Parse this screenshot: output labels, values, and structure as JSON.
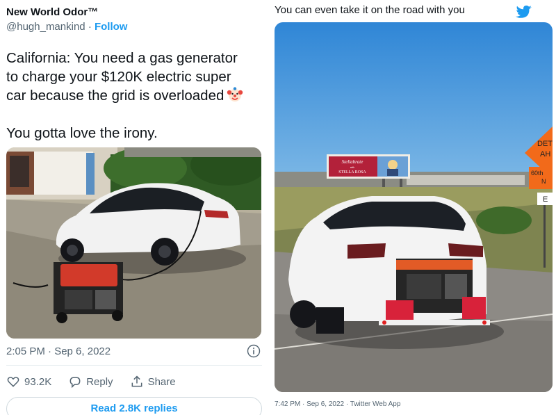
{
  "left_tweet": {
    "author_name": "New World Odor™",
    "handle": "@hugh_mankind",
    "separator": "·",
    "follow_label": "Follow",
    "text": "California: You need a gas generator\nto charge your $120K electric super\ncar because the grid is overloaded",
    "text_emoji": "clown-face-emoji",
    "text_line2": "You gotta love the irony.",
    "timestamp": "2:05 PM · Sep 6, 2022",
    "likes": "93.2K",
    "reply_label": "Reply",
    "share_label": "Share",
    "read_replies_label": "Read 2.8K replies",
    "icons": {
      "info": "info-icon",
      "like": "heart-icon",
      "reply": "reply-bubble-icon",
      "share": "share-icon"
    }
  },
  "right_tweet": {
    "text": "You can even take it on the road with you",
    "meta": "7:42 PM · Sep 6, 2022 · Twitter Web App",
    "billboard_script": "Stellabrate",
    "billboard_small": "with",
    "billboard_brand": "STELLA ROSA",
    "sign_text_1": "DET",
    "sign_text_2": "AH",
    "sign_text_3": "60th",
    "sign_text_4": "N",
    "sign_text_5": "E",
    "icons": {
      "logo": "twitter-bird-icon"
    }
  },
  "colors": {
    "link_blue": "#1d9bf0",
    "secondary_text": "#536471",
    "primary_text": "#0f1419",
    "twitter_blue": "#1d9bf0"
  }
}
